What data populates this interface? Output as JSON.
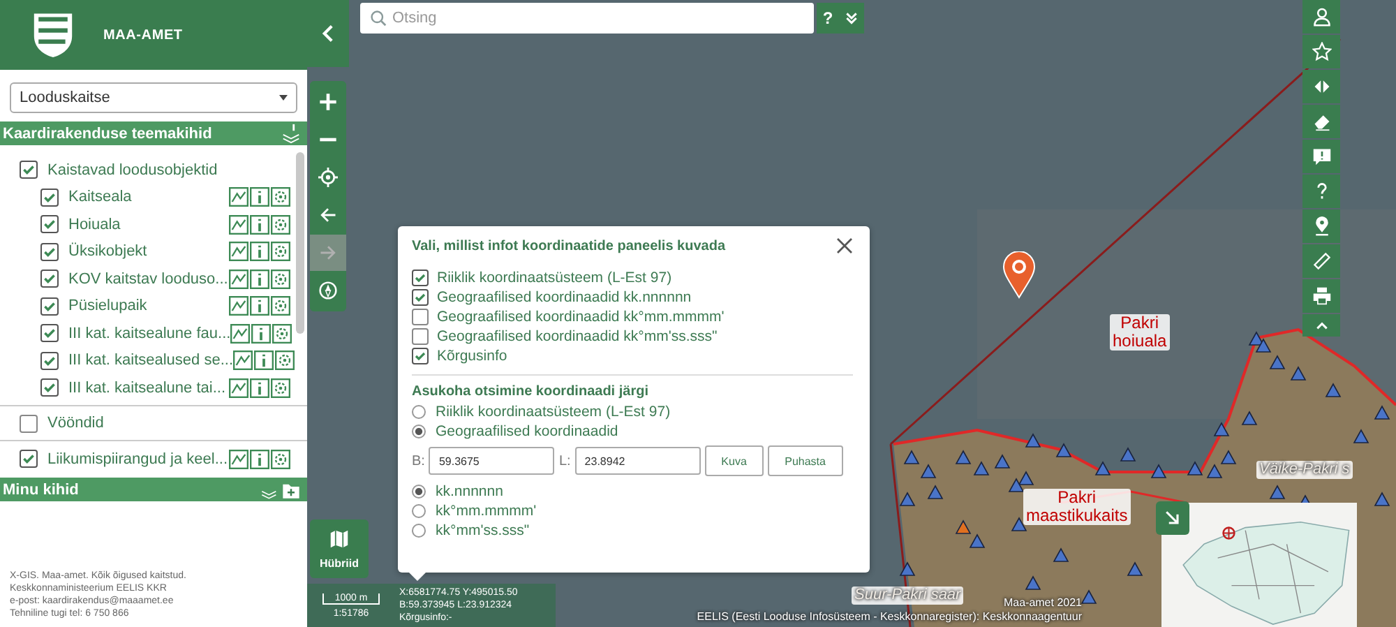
{
  "header": {
    "title": "MAA-AMET"
  },
  "theme_select": {
    "value": "Looduskaitse"
  },
  "layers_panel": {
    "title": "Kaardirakenduse teemakihid",
    "groups": [
      {
        "label": "Kaistavad loodusobjektid",
        "checked": true,
        "has_tools": false,
        "children": [
          {
            "label": "Kaitseala",
            "checked": true
          },
          {
            "label": "Hoiuala",
            "checked": true
          },
          {
            "label": "Üksikobjekt",
            "checked": true
          },
          {
            "label": "KOV kaitstav looduso...",
            "checked": true
          },
          {
            "label": "Püsielupaik",
            "checked": true
          },
          {
            "label": "III kat. kaitsealune fau...",
            "checked": true
          },
          {
            "label": "III kat. kaitsealused se...",
            "checked": true
          },
          {
            "label": "III kat. kaitsealune tai...",
            "checked": true
          }
        ]
      },
      {
        "label": "Vööndid",
        "checked": false,
        "has_tools": false
      },
      {
        "label": "Liikumispiirangud ja keel...",
        "checked": true,
        "has_tools": true
      }
    ]
  },
  "my_layers": {
    "title": "Minu kihid"
  },
  "footer": [
    "X-GIS. Maa-amet. Kõik õigused kaitstud.",
    "Keskkonnaministeerium EELIS KKR",
    "e-post: kaardirakendus@maaamet.ee",
    "Tehniline tugi tel: 6 750 866"
  ],
  "search": {
    "placeholder": "Otsing",
    "help": "?"
  },
  "basemap_button": {
    "label": "Hübriid"
  },
  "scale": {
    "distance": "1000 m",
    "ratio": "1:51786"
  },
  "coordinates": [
    "X:6581774.75 Y:495015.50",
    "B:59.373945 L:23.912324",
    "Kõrgusinfo:-"
  ],
  "map_labels": [
    {
      "kind": "area",
      "lines": [
        "Pakri",
        "hoiuala"
      ]
    },
    {
      "kind": "area",
      "lines": [
        "Pakri",
        "maastikukaits"
      ]
    },
    {
      "kind": "place",
      "lines": [
        "Suur-Pakri saar"
      ]
    },
    {
      "kind": "place",
      "lines": [
        "Väike-Pakri s"
      ]
    }
  ],
  "attribution": [
    "Maa-amet 2021",
    "EELIS (Eesti Looduse Infosüsteem - Keskkonnaregister): Keskkonnaagentuur"
  ],
  "dialog": {
    "title": "Vali, millist infot koordinaatide paneelis kuvada",
    "display_options": [
      {
        "label": "Riiklik koordinaatsüsteem (L-Est 97)",
        "checked": true
      },
      {
        "label": "Geograafilised koordinaadid kk.nnnnnn",
        "checked": true
      },
      {
        "label": "Geograafilised koordinaadid kk°mm.mmmm'",
        "checked": false
      },
      {
        "label": "Geograafilised koordinaadid kk°mm'ss.sss\"",
        "checked": false
      },
      {
        "label": "Kõrgusinfo",
        "checked": true
      }
    ],
    "search_title": "Asukoha otsimine koordinaadi järgi",
    "systems": [
      {
        "label": "Riiklik koordinaatsüsteem (L-Est 97)",
        "selected": false
      },
      {
        "label": "Geograafilised koordinaadid",
        "selected": true
      }
    ],
    "b_label": "B:",
    "b_value": "59.3675",
    "l_label": "L:",
    "l_value": "23.8942",
    "buttons": [
      "Kuva",
      "Puhasta"
    ],
    "formats": [
      {
        "label": "kk.nnnnnn",
        "selected": true
      },
      {
        "label": "kk°mm.mmmm'",
        "selected": false
      },
      {
        "label": "kk°mm'ss.sss\"",
        "selected": false
      }
    ]
  }
}
